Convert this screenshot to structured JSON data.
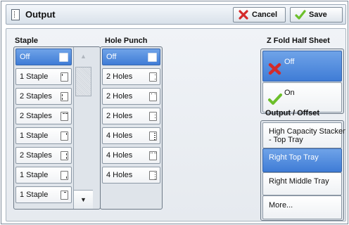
{
  "header": {
    "title": "Output",
    "cancel_label": "Cancel",
    "save_label": "Save"
  },
  "staple": {
    "label": "Staple",
    "items": [
      {
        "label": "Off",
        "selected": true
      },
      {
        "label": "1 Staple",
        "selected": false
      },
      {
        "label": "2 Staples",
        "selected": false
      },
      {
        "label": "2 Staples",
        "selected": false
      },
      {
        "label": "1 Staple",
        "selected": false
      },
      {
        "label": "2 Staples",
        "selected": false
      },
      {
        "label": "1 Staple",
        "selected": false
      },
      {
        "label": "1 Staple",
        "selected": false
      }
    ]
  },
  "hole_punch": {
    "label": "Hole Punch",
    "items": [
      {
        "label": "Off",
        "selected": true
      },
      {
        "label": "2 Holes",
        "selected": false
      },
      {
        "label": "2 Holes",
        "selected": false
      },
      {
        "label": "2 Holes",
        "selected": false
      },
      {
        "label": "4 Holes",
        "selected": false
      },
      {
        "label": "4 Holes",
        "selected": false
      },
      {
        "label": "4 Holes",
        "selected": false
      }
    ]
  },
  "z_fold": {
    "label": "Z Fold Half Sheet",
    "options": [
      {
        "label": "Off",
        "selected": true
      },
      {
        "label": "On",
        "selected": false
      }
    ]
  },
  "output_offset": {
    "label": "Output / Offset",
    "options": [
      {
        "label": "High Capacity Stacker - Top Tray",
        "selected": false
      },
      {
        "label": "Right Top Tray",
        "selected": true
      },
      {
        "label": "Right Middle Tray",
        "selected": false
      },
      {
        "label": "More...",
        "selected": false
      }
    ]
  },
  "colors": {
    "selected": "#4a86dc",
    "cancel_x": "#d42a2a",
    "check": "#6cbf2b"
  }
}
